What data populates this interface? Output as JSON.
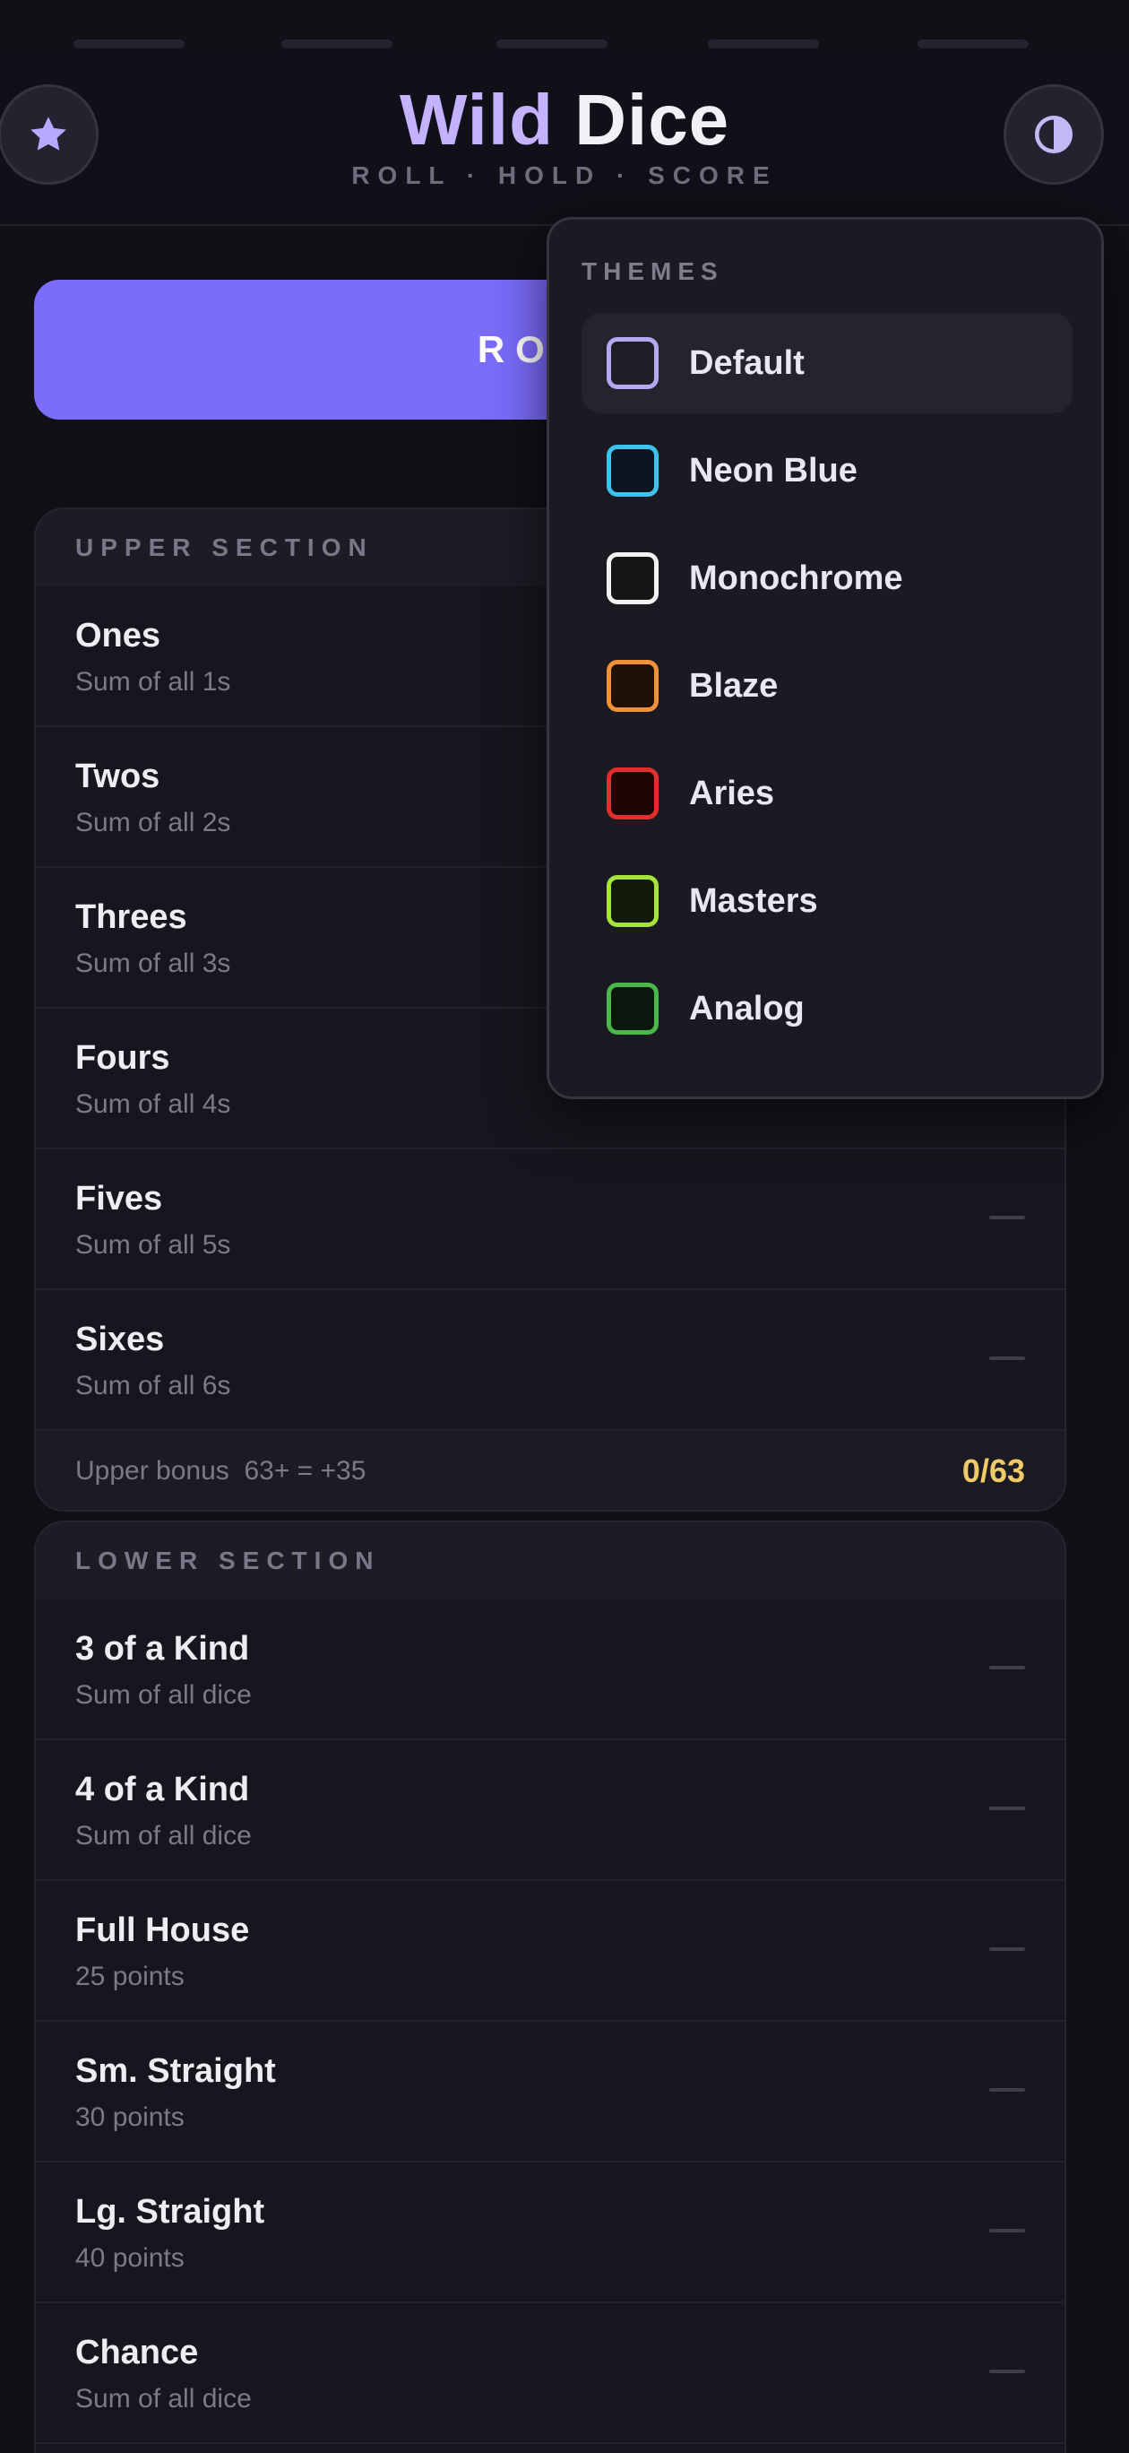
{
  "app": {
    "title_part1": "Wild",
    "title_part2": "Dice",
    "tagline": "ROLL · HOLD · SCORE",
    "left_button_icon": "star-icon",
    "right_button_icon": "contrast-icon",
    "roll_label": "ROLL"
  },
  "upper": {
    "header": "UPPER SECTION",
    "rows": [
      {
        "name": "Ones",
        "desc": "Sum of all 1s"
      },
      {
        "name": "Twos",
        "desc": "Sum of all 2s"
      },
      {
        "name": "Threes",
        "desc": "Sum of all 3s"
      },
      {
        "name": "Fours",
        "desc": "Sum of all 4s"
      },
      {
        "name": "Fives",
        "desc": "Sum of all 5s"
      },
      {
        "name": "Sixes",
        "desc": "Sum of all 6s"
      }
    ],
    "bonus_label": "Upper bonus  63+ = +35",
    "bonus_value": "0/63"
  },
  "lower": {
    "header": "LOWER SECTION",
    "rows": [
      {
        "name": "3 of a Kind",
        "desc": "Sum of all dice"
      },
      {
        "name": "4 of a Kind",
        "desc": "Sum of all dice"
      },
      {
        "name": "Full House",
        "desc": "25 points"
      },
      {
        "name": "Sm. Straight",
        "desc": "30 points"
      },
      {
        "name": "Lg. Straight",
        "desc": "40 points"
      },
      {
        "name": "Chance",
        "desc": "Sum of all dice"
      }
    ]
  },
  "themes": {
    "header": "THEMES",
    "selected": "Default",
    "items": [
      {
        "label": "Default",
        "color": "#b4a8f0",
        "fill": "#1f1e28"
      },
      {
        "label": "Neon Blue",
        "color": "#3fc3ee",
        "fill": "#0b1622"
      },
      {
        "label": "Monochrome",
        "color": "#f2f2f2",
        "fill": "#161616"
      },
      {
        "label": "Blaze",
        "color": "#f0923a",
        "fill": "#1e1208"
      },
      {
        "label": "Aries",
        "color": "#e0302d",
        "fill": "#1e0606"
      },
      {
        "label": "Masters",
        "color": "#a8e23c",
        "fill": "#111a08"
      },
      {
        "label": "Analog",
        "color": "#4cb84c",
        "fill": "#0b170c"
      }
    ]
  },
  "colors": {
    "accent": "#7b6cfa",
    "bonus": "#f0c968",
    "title_accent": "#c3b3ff"
  }
}
